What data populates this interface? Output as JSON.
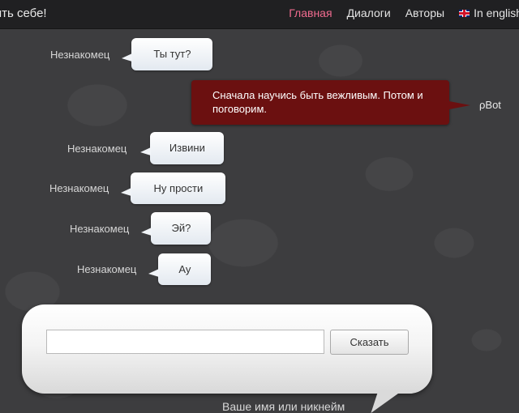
{
  "header": {
    "site_title": "ять себе!",
    "nav": {
      "home": "Главная",
      "dialogs": "Диалоги",
      "authors": "Авторы",
      "english": "In english"
    }
  },
  "messages": [
    {
      "author": "Незнакомец",
      "text": "Ты тут?"
    },
    {
      "author": "ρBot",
      "text": "Сначала научись быть вежливым. Потом и поговорим."
    },
    {
      "author": "Незнакомец",
      "text": "Извини"
    },
    {
      "author": "Незнакомец",
      "text": "Ну прости"
    },
    {
      "author": "Незнакомец",
      "text": "Эй?"
    },
    {
      "author": "Незнакомец",
      "text": "Ау"
    }
  ],
  "input": {
    "value": "",
    "say_label": "Сказать",
    "nickname_label": "Ваше имя или никнейм"
  },
  "colors": {
    "background": "#3d3d3f",
    "topbar": "#202022",
    "nav_active": "#f06b8f",
    "bot_bubble": "#6b1010",
    "user_bubble": "#f1f4f8"
  },
  "icons": {
    "language": "uk-flag-icon"
  }
}
